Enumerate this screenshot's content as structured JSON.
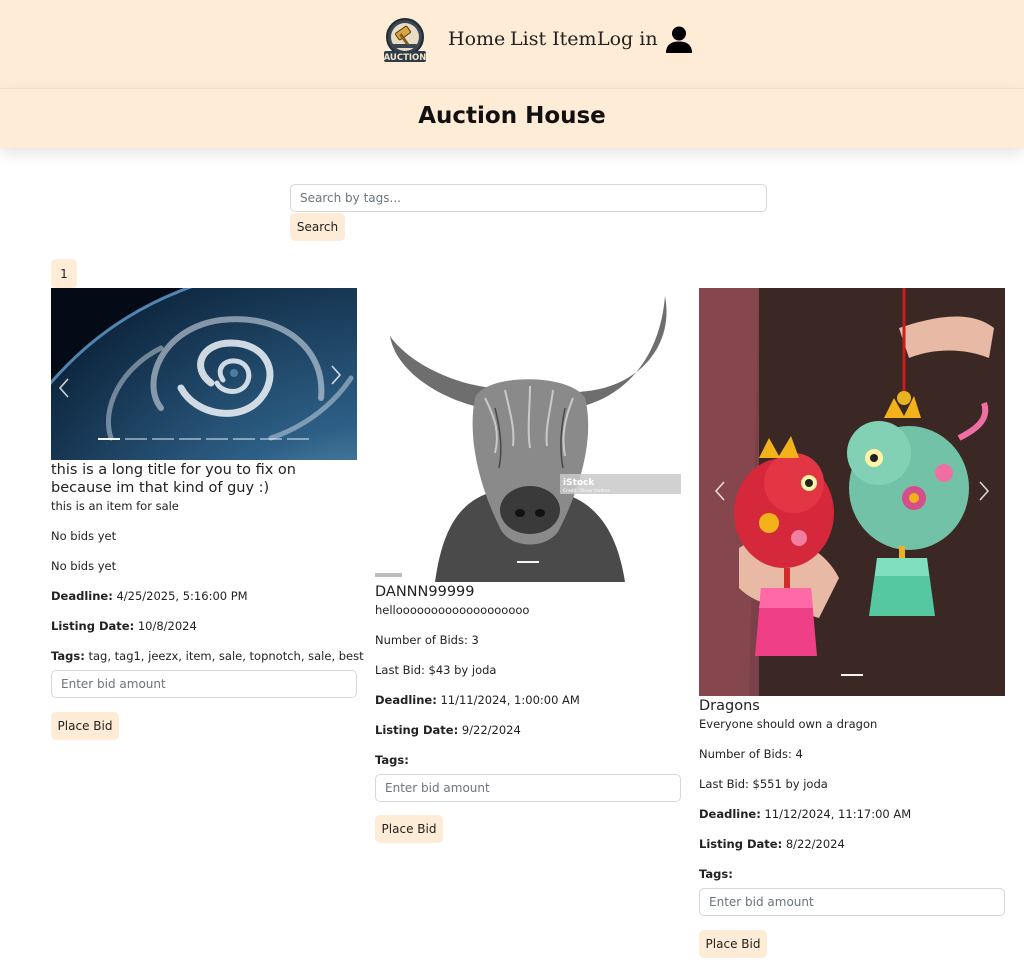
{
  "nav": {
    "logo_text": "AUCTION",
    "links": [
      "Home",
      "List Item",
      "Log in"
    ]
  },
  "header": {
    "title": "Auction House"
  },
  "search": {
    "placeholder": "Search by tags...",
    "button_label": "Search"
  },
  "pagination": {
    "current_page": "1"
  },
  "labels": {
    "deadline": "Deadline:",
    "listing_date": "Listing Date:",
    "tags": "Tags:",
    "bid_placeholder": "Enter bid amount",
    "place_bid": "Place Bid"
  },
  "items": [
    {
      "title": "this is a long title for you to fix on because im that kind of guy :)",
      "description": "this is an item for sale",
      "bids_line": "No bids yet",
      "last_bid_line": "No bids yet",
      "deadline": "4/25/2025, 5:16:00 PM",
      "listing_date": "10/8/2024",
      "tags": "tag, tag1, jeezx, item, sale, topnotch, sale, best",
      "image": "earth-hurricane-image"
    },
    {
      "title": "DANNN99999",
      "description": "hellooooooooooooooooooo",
      "bids_line": "Number of Bids: 3",
      "last_bid_line": "Last Bid: $43 by joda",
      "deadline": "11/11/2024, 1:00:00 AM",
      "listing_date": "9/22/2024",
      "tags": "",
      "image": "highland-cow-image",
      "watermark": "iStock",
      "watermark_credit": "Credit: Oliver Hullme"
    },
    {
      "title": "Dragons",
      "description": "Everyone should own a dragon",
      "bids_line": "Number of Bids: 4",
      "last_bid_line": "Last Bid: $551 by joda",
      "deadline": "11/12/2024, 11:17:00 AM",
      "listing_date": "8/22/2024",
      "tags": "",
      "image": "dragon-plush-image"
    }
  ],
  "colors": {
    "accent_bg": "#ffecd6",
    "text": "#212529"
  }
}
